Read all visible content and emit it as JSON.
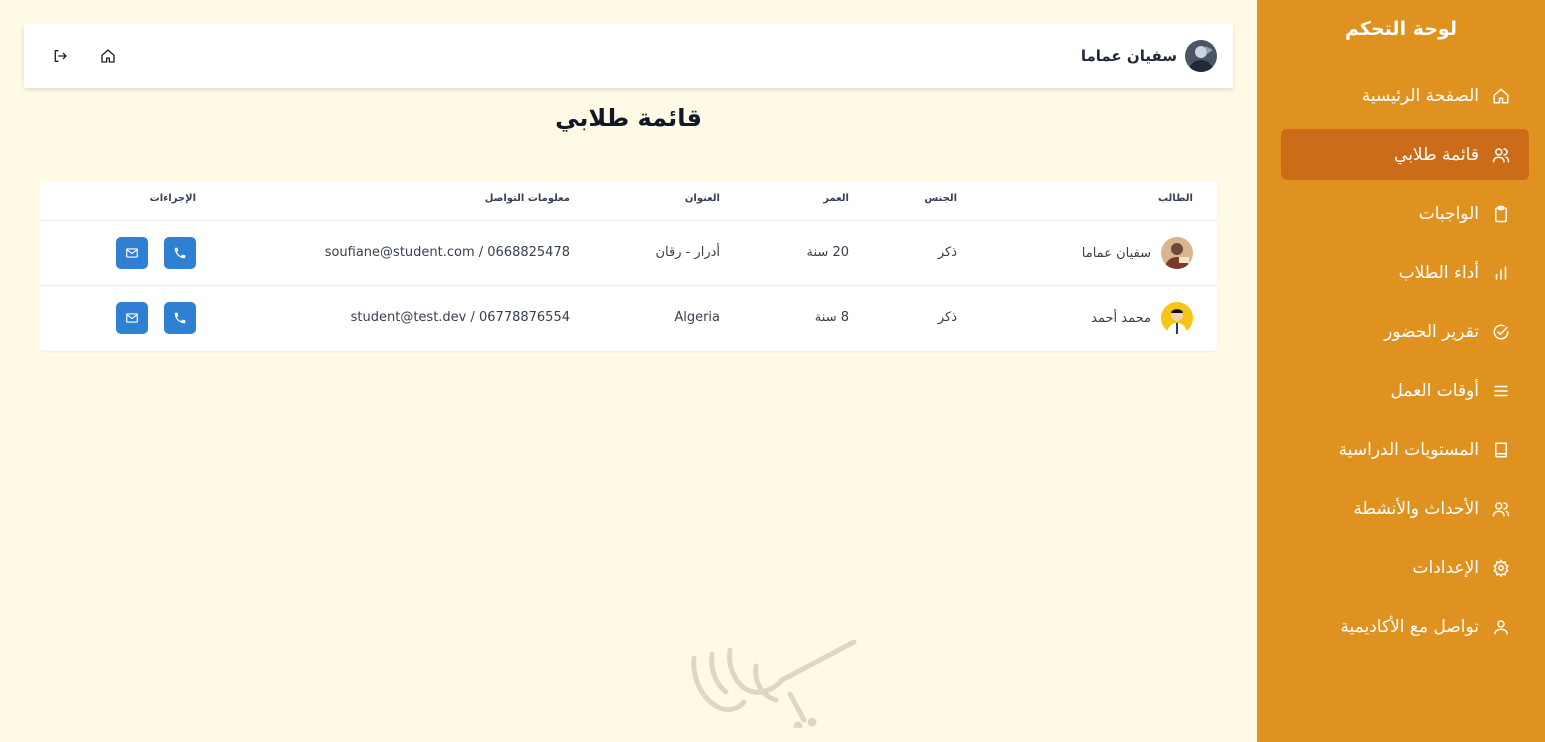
{
  "sidebar": {
    "title": "لوحة التحكم",
    "items": [
      {
        "label": "الصفحة الرئيسية",
        "icon": "home-icon",
        "active": false
      },
      {
        "label": "قائمة طلابي",
        "icon": "users-icon",
        "active": true
      },
      {
        "label": "الواجبات",
        "icon": "clipboard-icon",
        "active": false
      },
      {
        "label": "أداء الطلاب",
        "icon": "bar-chart-icon",
        "active": false
      },
      {
        "label": "تقرير الحضور",
        "icon": "check-circle-icon",
        "active": false
      },
      {
        "label": "أوقات العمل",
        "icon": "menu-lines-icon",
        "active": false
      },
      {
        "label": "المستويات الدراسية",
        "icon": "book-icon",
        "active": false
      },
      {
        "label": "الأحداث والأنشطة",
        "icon": "users-icon",
        "active": false
      },
      {
        "label": "الإعدادات",
        "icon": "gear-icon",
        "active": false
      },
      {
        "label": "تواصل مع الأكاديمية",
        "icon": "user-icon",
        "active": false
      }
    ]
  },
  "header": {
    "user_name": "سفيان عماما",
    "home_icon": "home-icon",
    "logout_icon": "logout-icon"
  },
  "page": {
    "title": "قائمة طلابي"
  },
  "table": {
    "headers": {
      "student": "الطالب",
      "gender": "الجنس",
      "age": "العمر",
      "address": "العنوان",
      "contact": "معلومات التواصل",
      "actions": "الإجراءات"
    },
    "rows": [
      {
        "name": "سفيان عماما",
        "gender": "ذكر",
        "age": "20 سنة",
        "address": "أدرار - رقان",
        "contact": "soufiane@student.com / 0668825478"
      },
      {
        "name": "محمد أحمد",
        "gender": "ذكر",
        "age": "8 سنة",
        "address": "Algeria",
        "contact": "student@test.dev / 06778876554"
      }
    ]
  },
  "colors": {
    "sidebar_bg": "#df921f",
    "sidebar_active": "#cc6c18",
    "page_bg": "#fffae6",
    "action_button": "#2f80d3"
  }
}
